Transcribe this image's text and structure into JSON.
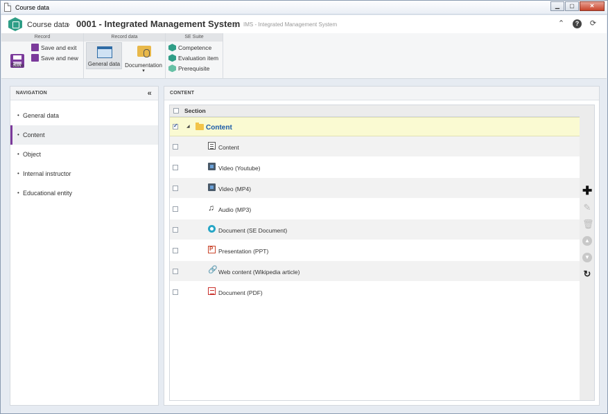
{
  "window": {
    "title": "Course data",
    "buttons": {
      "minimize": "▁",
      "maximize": "▢",
      "close": "✕"
    }
  },
  "header": {
    "crumb_root": "Course data",
    "crumb_sep": "›",
    "crumb_current": "0001 - Integrated Management System",
    "pipe": "|",
    "subtitle": "IMS - Integrated Management System",
    "icons": {
      "collapse": "⌃",
      "help": "?",
      "refresh": "⟳"
    }
  },
  "ribbon": {
    "groups": {
      "record": "Record",
      "record_data": "Record data",
      "se_suite": "SE Suite"
    },
    "save": "Save",
    "save_and_exit": "Save and exit",
    "save_and_new": "Save and new",
    "general_data": "General data",
    "documentation": "Documentation",
    "documentation_arrow": "▾",
    "competence": "Competence",
    "evaluation_item": "Evaluation item",
    "prerequisite": "Prerequisite"
  },
  "navigation": {
    "title": "NAVIGATION",
    "collapse": "«",
    "items": [
      {
        "label": "General data",
        "active": false
      },
      {
        "label": "Content",
        "active": true
      },
      {
        "label": "Object",
        "active": false
      },
      {
        "label": "Internal instructor",
        "active": false
      },
      {
        "label": "Educational entity",
        "active": false
      }
    ]
  },
  "content": {
    "title": "CONTENT",
    "grid": {
      "column": "Section",
      "root": {
        "label": "Content",
        "checked": true,
        "expander": "◢"
      },
      "rows": [
        {
          "label": "Content",
          "icon": "content-icon"
        },
        {
          "label": "Video (Youtube)",
          "icon": "video-icon"
        },
        {
          "label": "Video (MP4)",
          "icon": "video-icon"
        },
        {
          "label": "Audio (MP3)",
          "icon": "audio-icon",
          "glyph": "♫"
        },
        {
          "label": "Document (SE Document)",
          "icon": "se-document-icon"
        },
        {
          "label": "Presentation (PPT)",
          "icon": "ppt-icon"
        },
        {
          "label": "Web content (Wikipedia article)",
          "icon": "link-icon",
          "glyph": "🔗"
        },
        {
          "label": "Document (PDF)",
          "icon": "pdf-icon"
        }
      ]
    },
    "tools": {
      "add": "✚",
      "edit": "✎",
      "delete": "🗑",
      "move_up": "▲",
      "move_down": "▼",
      "refresh": "↻"
    }
  },
  "colors": {
    "accent": "#7b3a9b",
    "brand": "#2f9e87",
    "selected_row": "#fafad2",
    "root_label": "#1a5aa8"
  }
}
